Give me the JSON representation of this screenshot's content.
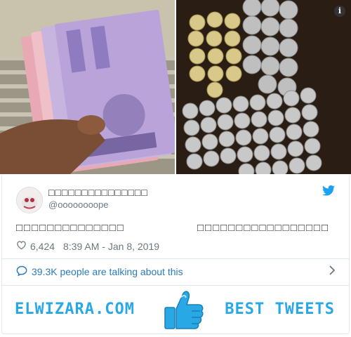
{
  "media": {
    "left_photo_icon": "banknotes-photo",
    "right_photo_icon": "coins-photo",
    "info_label": "i"
  },
  "tweet": {
    "display_name": "□□□□□□□□□□□□□□□",
    "handle": "@oooooooope",
    "text_part1": "□□□□□□□□□□□□□□",
    "text_part2": "□□□□□□□□□□□□□□□□□",
    "likes": "6,424",
    "timestamp": "8:39 AM - Jan 8, 2019"
  },
  "talking": {
    "label": "39.3K people are talking about this"
  },
  "banner": {
    "site": "ELWIZARA.COM",
    "tagline": "BEST TWEETS"
  },
  "colors": {
    "twitter_blue": "#1da1f2",
    "link_blue": "#2b7bb9",
    "banner_blue": "#2aa8e6",
    "text_dark": "#1c2022",
    "text_gray": "#697882"
  }
}
